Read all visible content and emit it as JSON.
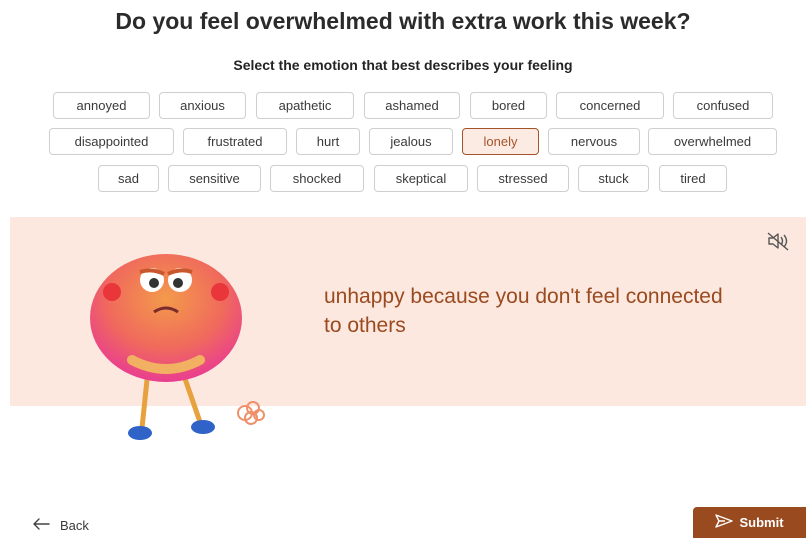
{
  "survey": {
    "question": "Do you feel overwhelmed with extra work this week?",
    "subtitle": "Select the emotion that best describes your feeling",
    "emotions": [
      "annoyed",
      "anxious",
      "apathetic",
      "ashamed",
      "bored",
      "concerned",
      "confused",
      "disappointed",
      "frustrated",
      "hurt",
      "jealous",
      "lonely",
      "nervous",
      "overwhelmed",
      "sad",
      "sensitive",
      "shocked",
      "skeptical",
      "stressed",
      "stuck",
      "tired"
    ],
    "selected_emotion": "lonely",
    "selected_description": "unhappy because you don't feel connected to others",
    "mute_icon": "speaker-muted-icon",
    "character_icon": "fuzzy-monster-character-icon"
  },
  "footer": {
    "back_label": "Back",
    "back_icon": "arrow-left-icon",
    "submit_label": "Submit",
    "submit_icon": "send-icon"
  },
  "colors": {
    "accent": "#9a4a1f",
    "banner_background": "#fde8df",
    "selected_chip_border": "#a4542a",
    "selected_chip_background": "#fcebe2",
    "chip_border": "#cfcfcf"
  }
}
